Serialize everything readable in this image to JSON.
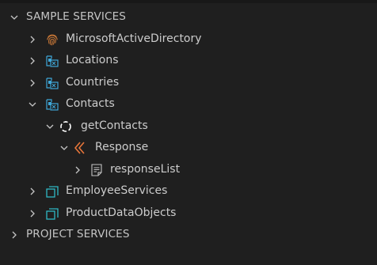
{
  "colors": {
    "background": "#1f1f1f",
    "text": "#cccccc",
    "chevron": "#c5c5c5",
    "fingerprint": "#c77737",
    "api_icon": "#3fa7d8",
    "service_icon": "#2fb7c4",
    "response_icon": "#e8763a"
  },
  "tree": {
    "sample_services": {
      "label": "SAMPLE SERVICES",
      "expanded": true
    },
    "items": [
      {
        "label": "MicrosoftActiveDirectory",
        "icon": "fingerprint-icon",
        "expanded": false
      },
      {
        "label": "Locations",
        "icon": "api-icon",
        "expanded": false
      },
      {
        "label": "Countries",
        "icon": "api-icon",
        "expanded": false
      },
      {
        "label": "Contacts",
        "icon": "api-icon",
        "expanded": true
      },
      {
        "label": "getContacts",
        "icon": "operation-icon",
        "expanded": true
      },
      {
        "label": "Response",
        "icon": "response-icon",
        "expanded": true
      },
      {
        "label": "responseList",
        "icon": "document-icon",
        "expanded": false
      },
      {
        "label": "EmployeeServices",
        "icon": "service-icon",
        "expanded": false
      },
      {
        "label": "ProductDataObjects",
        "icon": "service-icon",
        "expanded": false
      }
    ],
    "project_services": {
      "label": "PROJECT SERVICES",
      "expanded": false
    }
  }
}
